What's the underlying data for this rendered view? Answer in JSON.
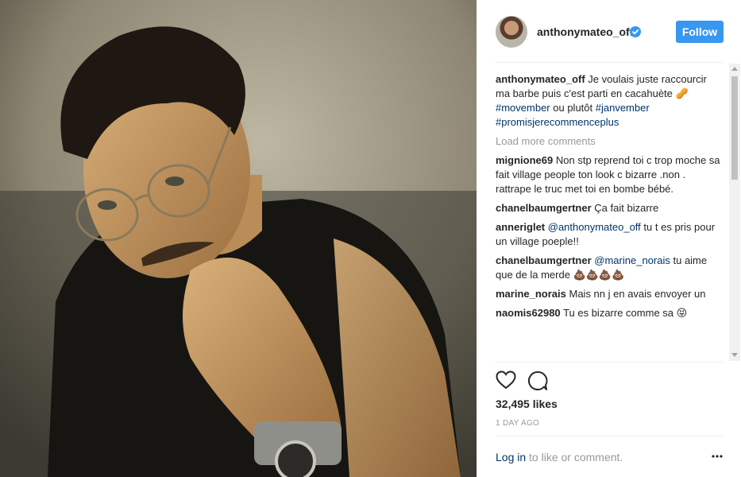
{
  "header": {
    "username": "anthonymateo_off",
    "follow_label": "Follow"
  },
  "caption": {
    "user": "anthonymateo_off",
    "text_1": " Je voulais juste raccourcir ma barbe puis c'est parti en cacahuète 🥜 ",
    "tag_1": "#movember",
    "text_2": " ou plutôt ",
    "tag_2": "#janvember",
    "tag_3": "#promisjerecommenceplus"
  },
  "load_more": "Load more comments",
  "comments": [
    {
      "user": "mignione69",
      "mention": "",
      "text": "Non stp reprend toi c trop moche sa fait village people ton look c bizarre .non . rattrape le truc met toi en bombe bébé."
    },
    {
      "user": "chanelbaumgertner",
      "mention": "",
      "text": "Ça fait bizarre"
    },
    {
      "user": "anneriglet",
      "mention": "@anthonymateo_off",
      "text": "tu t es pris pour un village poeple!!"
    },
    {
      "user": "chanelbaumgertner",
      "mention": "@marine_norais",
      "text": "tu aime que de la merde 💩💩💩💩"
    },
    {
      "user": "marine_norais",
      "mention": "",
      "text": "Mais nn j en avais envoyer un"
    },
    {
      "user": "naomis62980",
      "mention": "",
      "text": "Tu es bizarre comme sa 😝"
    }
  ],
  "likes": "32,495 likes",
  "time_ago": "1 DAY AGO",
  "footer": {
    "login_label": "Log in",
    "rest": " to like or comment."
  },
  "icons": {
    "verified": "verified-badge-icon",
    "heart": "heart-icon",
    "comment": "comment-bubble-icon",
    "more": "more-options-icon"
  },
  "colors": {
    "accent": "#3897f0",
    "link": "#003569",
    "muted": "#999999"
  }
}
